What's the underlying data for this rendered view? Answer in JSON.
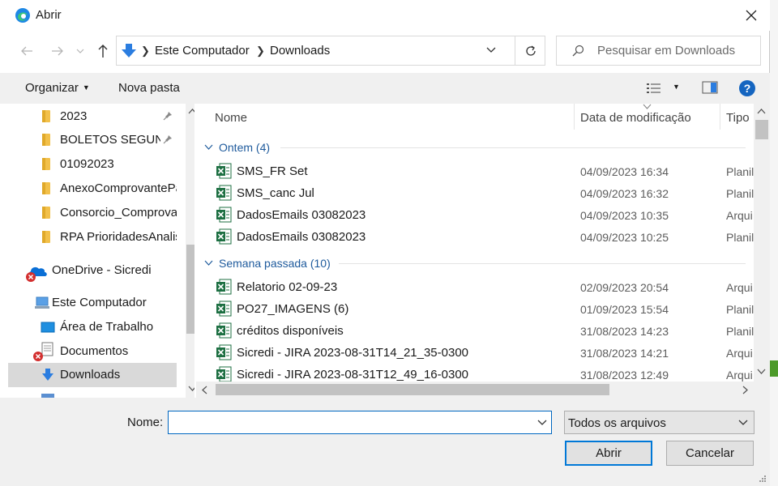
{
  "window": {
    "title": "Abrir"
  },
  "address": {
    "crumbs": [
      "Este Computador",
      "Downloads"
    ]
  },
  "search": {
    "placeholder": "Pesquisar em Downloads"
  },
  "toolbar": {
    "organize": "Organizar",
    "new_folder": "Nova pasta"
  },
  "sidebar": {
    "items": [
      {
        "label": "2023",
        "icon": "folder-icon",
        "pinned": true
      },
      {
        "label": "BOLETOS SEGUND.",
        "icon": "folder-icon",
        "pinned": true
      },
      {
        "label": "01092023",
        "icon": "folder-icon"
      },
      {
        "label": "AnexoComprovantePa",
        "icon": "folder-icon"
      },
      {
        "label": "Consorcio_Comprovar",
        "icon": "folder-icon"
      },
      {
        "label": "RPA PrioridadesAnalis",
        "icon": "folder-icon"
      },
      {
        "label": "OneDrive - Sicredi",
        "icon": "onedrive-icon"
      },
      {
        "label": "Este Computador",
        "icon": "computer-icon"
      },
      {
        "label": "Área de Trabalho",
        "icon": "desktop-icon"
      },
      {
        "label": "Documentos",
        "icon": "documents-icon"
      },
      {
        "label": "Downloads",
        "icon": "downloads-icon",
        "selected": true
      }
    ]
  },
  "columns": {
    "name": "Nome",
    "date": "Data de modificação",
    "type": "Tipo"
  },
  "groups": [
    {
      "label": "Ontem (4)",
      "files": [
        {
          "name": "SMS_FR Set",
          "date": "04/09/2023 16:34",
          "type": "Planil"
        },
        {
          "name": "SMS_canc Jul",
          "date": "04/09/2023 16:32",
          "type": "Planil"
        },
        {
          "name": "DadosEmails 03082023",
          "date": "04/09/2023 10:35",
          "type": "Arqui"
        },
        {
          "name": "DadosEmails 03082023",
          "date": "04/09/2023 10:25",
          "type": "Planil"
        }
      ]
    },
    {
      "label": "Semana passada (10)",
      "files": [
        {
          "name": "Relatorio 02-09-23",
          "date": "02/09/2023 20:54",
          "type": "Arqui"
        },
        {
          "name": "PO27_IMAGENS (6)",
          "date": "01/09/2023 15:54",
          "type": "Planil"
        },
        {
          "name": "créditos disponíveis",
          "date": "31/08/2023 14:23",
          "type": "Planil"
        },
        {
          "name": "Sicredi - JIRA 2023-08-31T14_21_35-0300",
          "date": "31/08/2023 14:21",
          "type": "Arqui"
        },
        {
          "name": "Sicredi - JIRA 2023-08-31T12_49_16-0300",
          "date": "31/08/2023 12:49",
          "type": "Arqui"
        }
      ]
    }
  ],
  "footer": {
    "name_label": "Nome:",
    "name_value": "",
    "filter": "Todos os arquivos",
    "open": "Abrir",
    "cancel": "Cancelar"
  },
  "colors": {
    "accent": "#0078d7",
    "excel": "#1d6f42",
    "folder": "#f2c04a",
    "group": "#1e5a9c"
  }
}
